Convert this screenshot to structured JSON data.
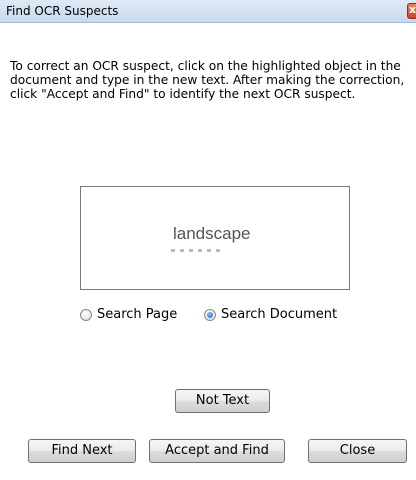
{
  "window": {
    "title": "Find OCR Suspects",
    "close_glyph": "x"
  },
  "instructions": "To correct an OCR suspect, click on the highlighted object in the document and type in the new text. After making the correction, click \"Accept and Find\" to identify the next OCR suspect.",
  "preview": {
    "word": "landscape"
  },
  "search_scope": {
    "options": [
      {
        "label": "Search Page",
        "selected": false
      },
      {
        "label": "Search Document",
        "selected": true
      }
    ]
  },
  "buttons": {
    "not_text": "Not Text",
    "find_next": "Find Next",
    "accept_and_find": "Accept and Find",
    "close": "Close"
  }
}
